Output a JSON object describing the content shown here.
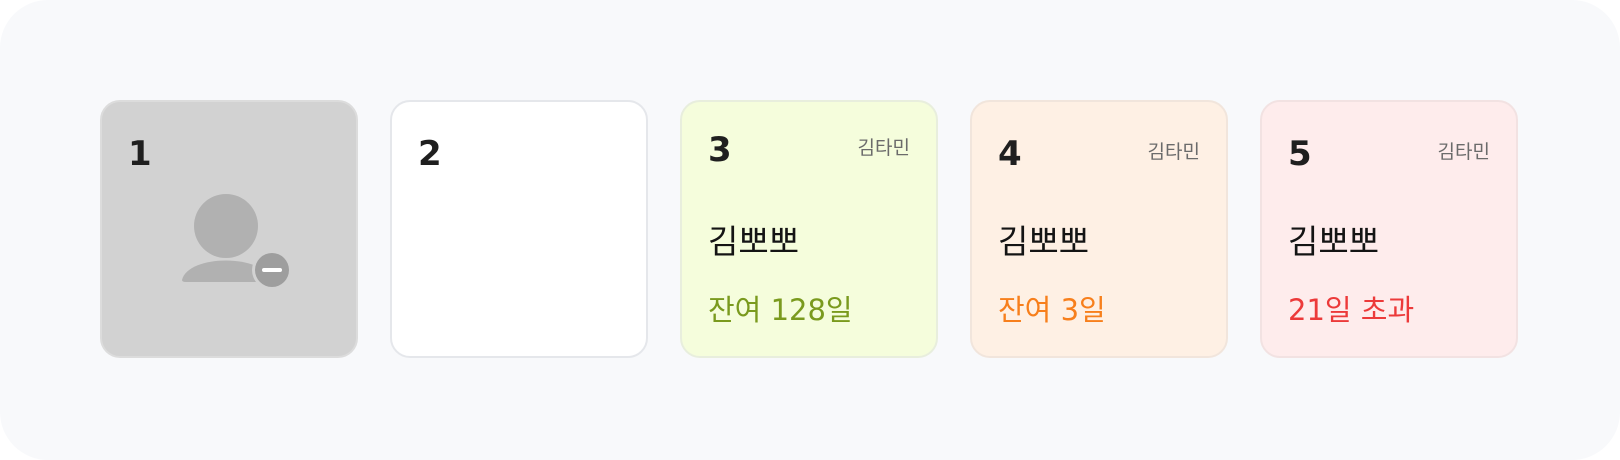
{
  "colors": {
    "panel_bg": "#f8f9fb",
    "disabled_bg": "#d2d2d2",
    "empty_bg": "#ffffff",
    "active_bg": "#f5fddc",
    "warning_bg": "#fef0e4",
    "overdue_bg": "#feecec",
    "active_text": "#7a9a1e",
    "warning_text": "#f77f1c",
    "overdue_text": "#ec3a3a"
  },
  "slots": [
    {
      "number": "1",
      "state": "disabled",
      "icon": "user-remove-icon"
    },
    {
      "number": "2",
      "state": "empty"
    },
    {
      "number": "3",
      "state": "active",
      "owner": "김타민",
      "member": "김뽀뽀",
      "status": "잔여 128일"
    },
    {
      "number": "4",
      "state": "warning",
      "owner": "김타민",
      "member": "김뽀뽀",
      "status": "잔여 3일"
    },
    {
      "number": "5",
      "state": "overdue",
      "owner": "김타민",
      "member": "김뽀뽀",
      "status": "21일 초과"
    }
  ]
}
